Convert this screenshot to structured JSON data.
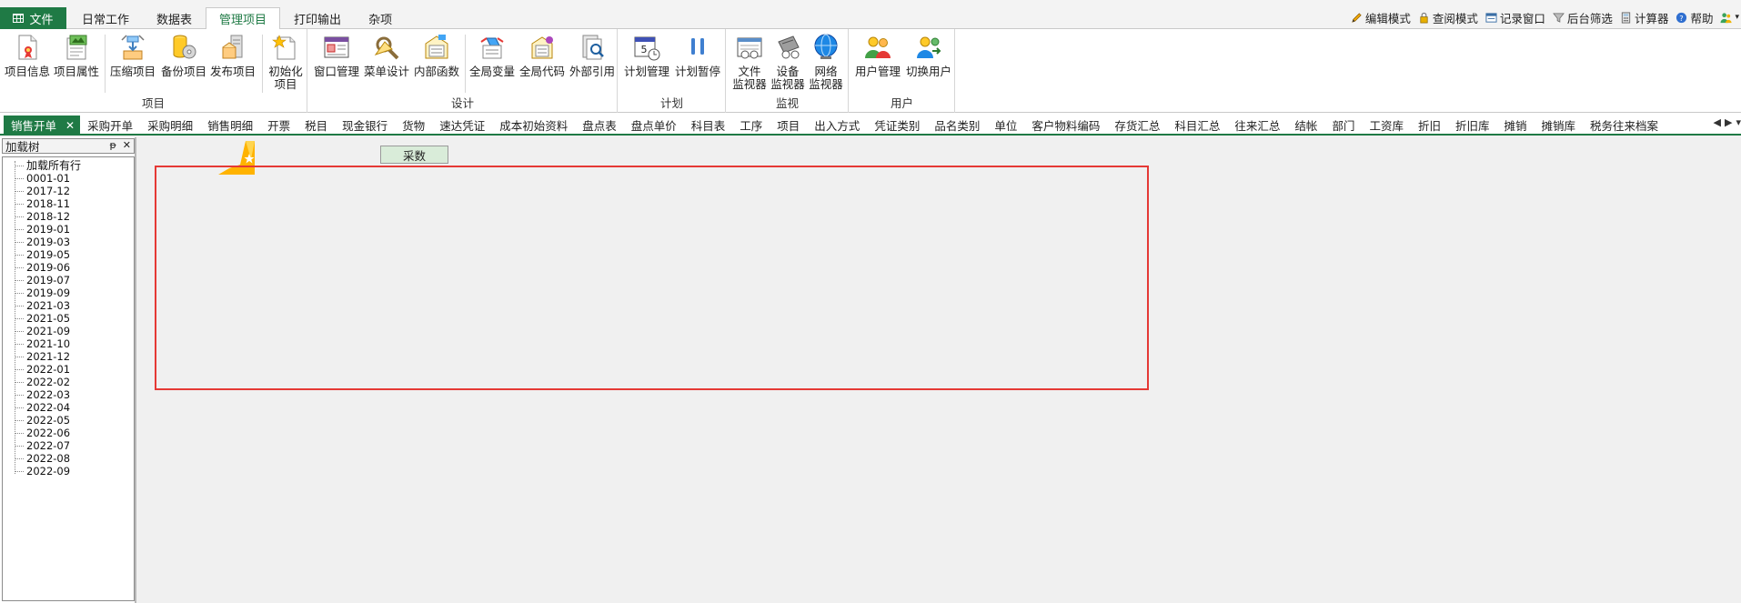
{
  "menubar": {
    "file_label": "文件",
    "tabs": [
      "日常工作",
      "数据表",
      "管理项目",
      "打印输出",
      "杂项"
    ],
    "active_tab": "管理项目",
    "right_tools": [
      {
        "label": "编辑模式",
        "icon": "pencil-icon"
      },
      {
        "label": "查阅模式",
        "icon": "lock-icon"
      },
      {
        "label": "记录窗口",
        "icon": "window-icon"
      },
      {
        "label": "后台筛选",
        "icon": "filter-icon"
      },
      {
        "label": "计算器",
        "icon": "calculator-icon"
      },
      {
        "label": "帮助",
        "icon": "help-icon"
      }
    ]
  },
  "ribbon": {
    "groups": [
      {
        "name": "项目",
        "buttons": [
          {
            "label": "项目信息",
            "icon": "project-info-icon"
          },
          {
            "label": "项目属性",
            "icon": "project-properties-icon"
          },
          {
            "label": "压缩项目",
            "icon": "compress-project-icon"
          },
          {
            "label": "备份项目",
            "icon": "backup-project-icon"
          },
          {
            "label": "发布项目",
            "icon": "publish-project-icon"
          },
          {
            "label": "初始化\n项目",
            "icon": "initialize-project-icon"
          }
        ]
      },
      {
        "name": "设计",
        "buttons": [
          {
            "label": "窗口管理",
            "icon": "window-manager-icon"
          },
          {
            "label": "菜单设计",
            "icon": "menu-design-icon"
          },
          {
            "label": "内部函数",
            "icon": "internal-function-icon"
          },
          {
            "label": "全局变量",
            "icon": "global-variable-icon"
          },
          {
            "label": "全局代码",
            "icon": "global-code-icon"
          },
          {
            "label": "外部引用",
            "icon": "external-reference-icon"
          }
        ]
      },
      {
        "name": "计划",
        "buttons": [
          {
            "label": "计划管理",
            "icon": "plan-calendar-icon"
          },
          {
            "label": "计划暂停",
            "icon": "pause-icon"
          }
        ]
      },
      {
        "name": "监视",
        "buttons": [
          {
            "label": "文件\n监视器",
            "icon": "file-monitor-icon"
          },
          {
            "label": "设备\n监视器",
            "icon": "device-monitor-icon"
          },
          {
            "label": "网络\n监视器",
            "icon": "globe-icon"
          }
        ]
      },
      {
        "name": "用户",
        "buttons": [
          {
            "label": "用户管理",
            "icon": "users-icon"
          },
          {
            "label": "切换用户",
            "icon": "switch-user-icon"
          }
        ]
      }
    ]
  },
  "doc_tabs": {
    "active": "销售开单",
    "items": [
      "销售开单",
      "采购开单",
      "采购明细",
      "销售明细",
      "开票",
      "税目",
      "现金银行",
      "货物",
      "速达凭证",
      "成本初始资料",
      "盘点表",
      "盘点单价",
      "科目表",
      "工序",
      "项目",
      "出入方式",
      "凭证类别",
      "品名类别",
      "单位",
      "客户物料编码",
      "存货汇总",
      "科目汇总",
      "往来汇总",
      "结帐",
      "部门",
      "工资库",
      "折旧",
      "折旧库",
      "摊销",
      "摊销库",
      "税务往来档案"
    ]
  },
  "left_panel": {
    "title": "加载树",
    "pin_glyph": "ᵽ",
    "close_glyph": "✕",
    "tree_items": [
      "加载所有行",
      "0001-01",
      "2017-12",
      "2018-11",
      "2018-12",
      "2019-01",
      "2019-03",
      "2019-05",
      "2019-06",
      "2019-07",
      "2019-09",
      "2021-03",
      "2021-05",
      "2021-09",
      "2021-10",
      "2021-12",
      "2022-01",
      "2022-02",
      "2022-03",
      "2022-04",
      "2022-05",
      "2022-06",
      "2022-07",
      "2022-08",
      "2022-09"
    ]
  },
  "main": {
    "label_box_text": "采数"
  },
  "colors": {
    "accent_green": "#1f7a45",
    "highlight_red": "#e53935",
    "label_box_bg": "#d9ecd9"
  }
}
